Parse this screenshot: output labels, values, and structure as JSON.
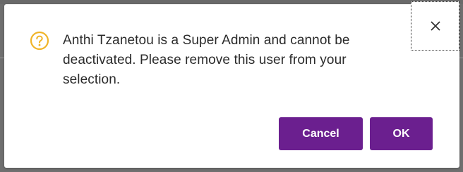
{
  "dialog": {
    "message": "Anthi Tzanetou is a Super Admin and cannot be deactivated. Please remove this user from your selection.",
    "icon": "warning-question-icon",
    "close_icon": "close-icon",
    "cancel_label": "Cancel",
    "ok_label": "OK"
  },
  "colors": {
    "accent": "#6b1f8f",
    "warning": "#f0b429",
    "overlay": "#6f6f6f"
  }
}
